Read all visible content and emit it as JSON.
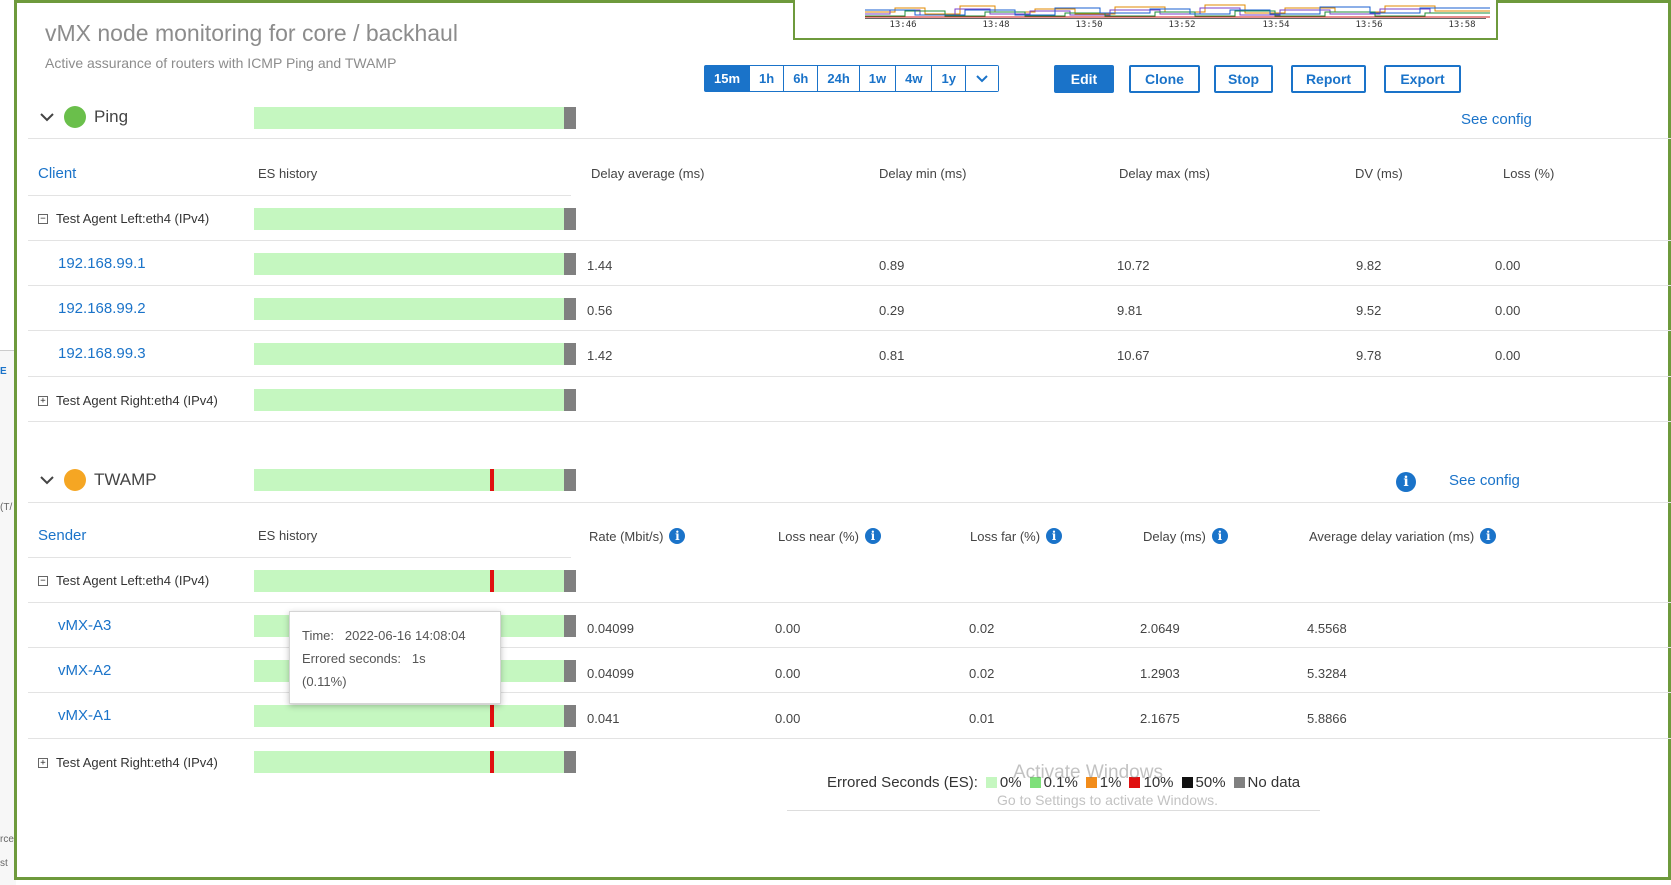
{
  "page": {
    "title": "vMX node monitoring for core / backhaul",
    "subtitle": "Active assurance of routers with ICMP Ping and TWAMP"
  },
  "mini_chart": {
    "ticks": [
      "13:46",
      "13:48",
      "13:50",
      "13:52",
      "13:54",
      "13:56",
      "13:58"
    ]
  },
  "toolbar": {
    "ranges": [
      "15m",
      "1h",
      "6h",
      "24h",
      "1w",
      "4w",
      "1y"
    ],
    "active_range": "15m",
    "edit": "Edit",
    "clone": "Clone",
    "stop": "Stop",
    "report": "Report",
    "export": "Export"
  },
  "ping": {
    "name": "Ping",
    "status_color": "#6abf4b",
    "see_config": "See config",
    "columns": [
      "Client",
      "ES history",
      "Delay average (ms)",
      "Delay min (ms)",
      "Delay max (ms)",
      "DV (ms)",
      "Loss (%)"
    ],
    "agent_left": "Test Agent Left:eth4 (IPv4)",
    "agent_right": "Test Agent Right:eth4 (IPv4)",
    "rows": [
      {
        "host": "192.168.99.1",
        "avg": "1.44",
        "min": "0.89",
        "max": "10.72",
        "dv": "9.82",
        "loss": "0.00"
      },
      {
        "host": "192.168.99.2",
        "avg": "0.56",
        "min": "0.29",
        "max": "9.81",
        "dv": "9.52",
        "loss": "0.00"
      },
      {
        "host": "192.168.99.3",
        "avg": "1.42",
        "min": "0.81",
        "max": "10.67",
        "dv": "9.78",
        "loss": "0.00"
      }
    ]
  },
  "twamp": {
    "name": "TWAMP",
    "status_color": "#f5a623",
    "see_config": "See config",
    "columns": [
      "Sender",
      "ES history",
      "Rate (Mbit/s)",
      "Loss near (%)",
      "Loss far (%)",
      "Delay (ms)",
      "Average delay variation (ms)"
    ],
    "agent_left": "Test Agent Left:eth4 (IPv4)",
    "agent_right": "Test Agent Right:eth4 (IPv4)",
    "rows": [
      {
        "host": "vMX-A3",
        "rate": "0.04099",
        "loss_near": "0.00",
        "loss_far": "0.02",
        "delay": "2.0649",
        "adv": "4.5568"
      },
      {
        "host": "vMX-A2",
        "rate": "0.04099",
        "loss_near": "0.00",
        "loss_far": "0.02",
        "delay": "1.2903",
        "adv": "5.3284"
      },
      {
        "host": "vMX-A1",
        "rate": "0.041",
        "loss_near": "0.00",
        "loss_far": "0.01",
        "delay": "2.1675",
        "adv": "5.8866"
      }
    ]
  },
  "tooltip": {
    "time_label": "Time:",
    "time_value": "2022-06-16 14:08:04",
    "es_label": "Errored seconds:",
    "es_value": "1s",
    "es_pct": "(0.11%)"
  },
  "legend": {
    "label": "Errored Seconds (ES):",
    "items": [
      {
        "label": "0%",
        "color": "#c5f7c0"
      },
      {
        "label": "0.1%",
        "color": "#7ee07a"
      },
      {
        "label": "1%",
        "color": "#f28c1a"
      },
      {
        "label": "10%",
        "color": "#e01010"
      },
      {
        "label": "50%",
        "color": "#111111"
      },
      {
        "label": "No data",
        "color": "#808080"
      }
    ]
  },
  "watermark": {
    "line1": "Activate Windows",
    "line2": "Go to Settings to activate Windows."
  },
  "background_fragments": [
    "E",
    "(T/",
    "rce",
    "st"
  ]
}
